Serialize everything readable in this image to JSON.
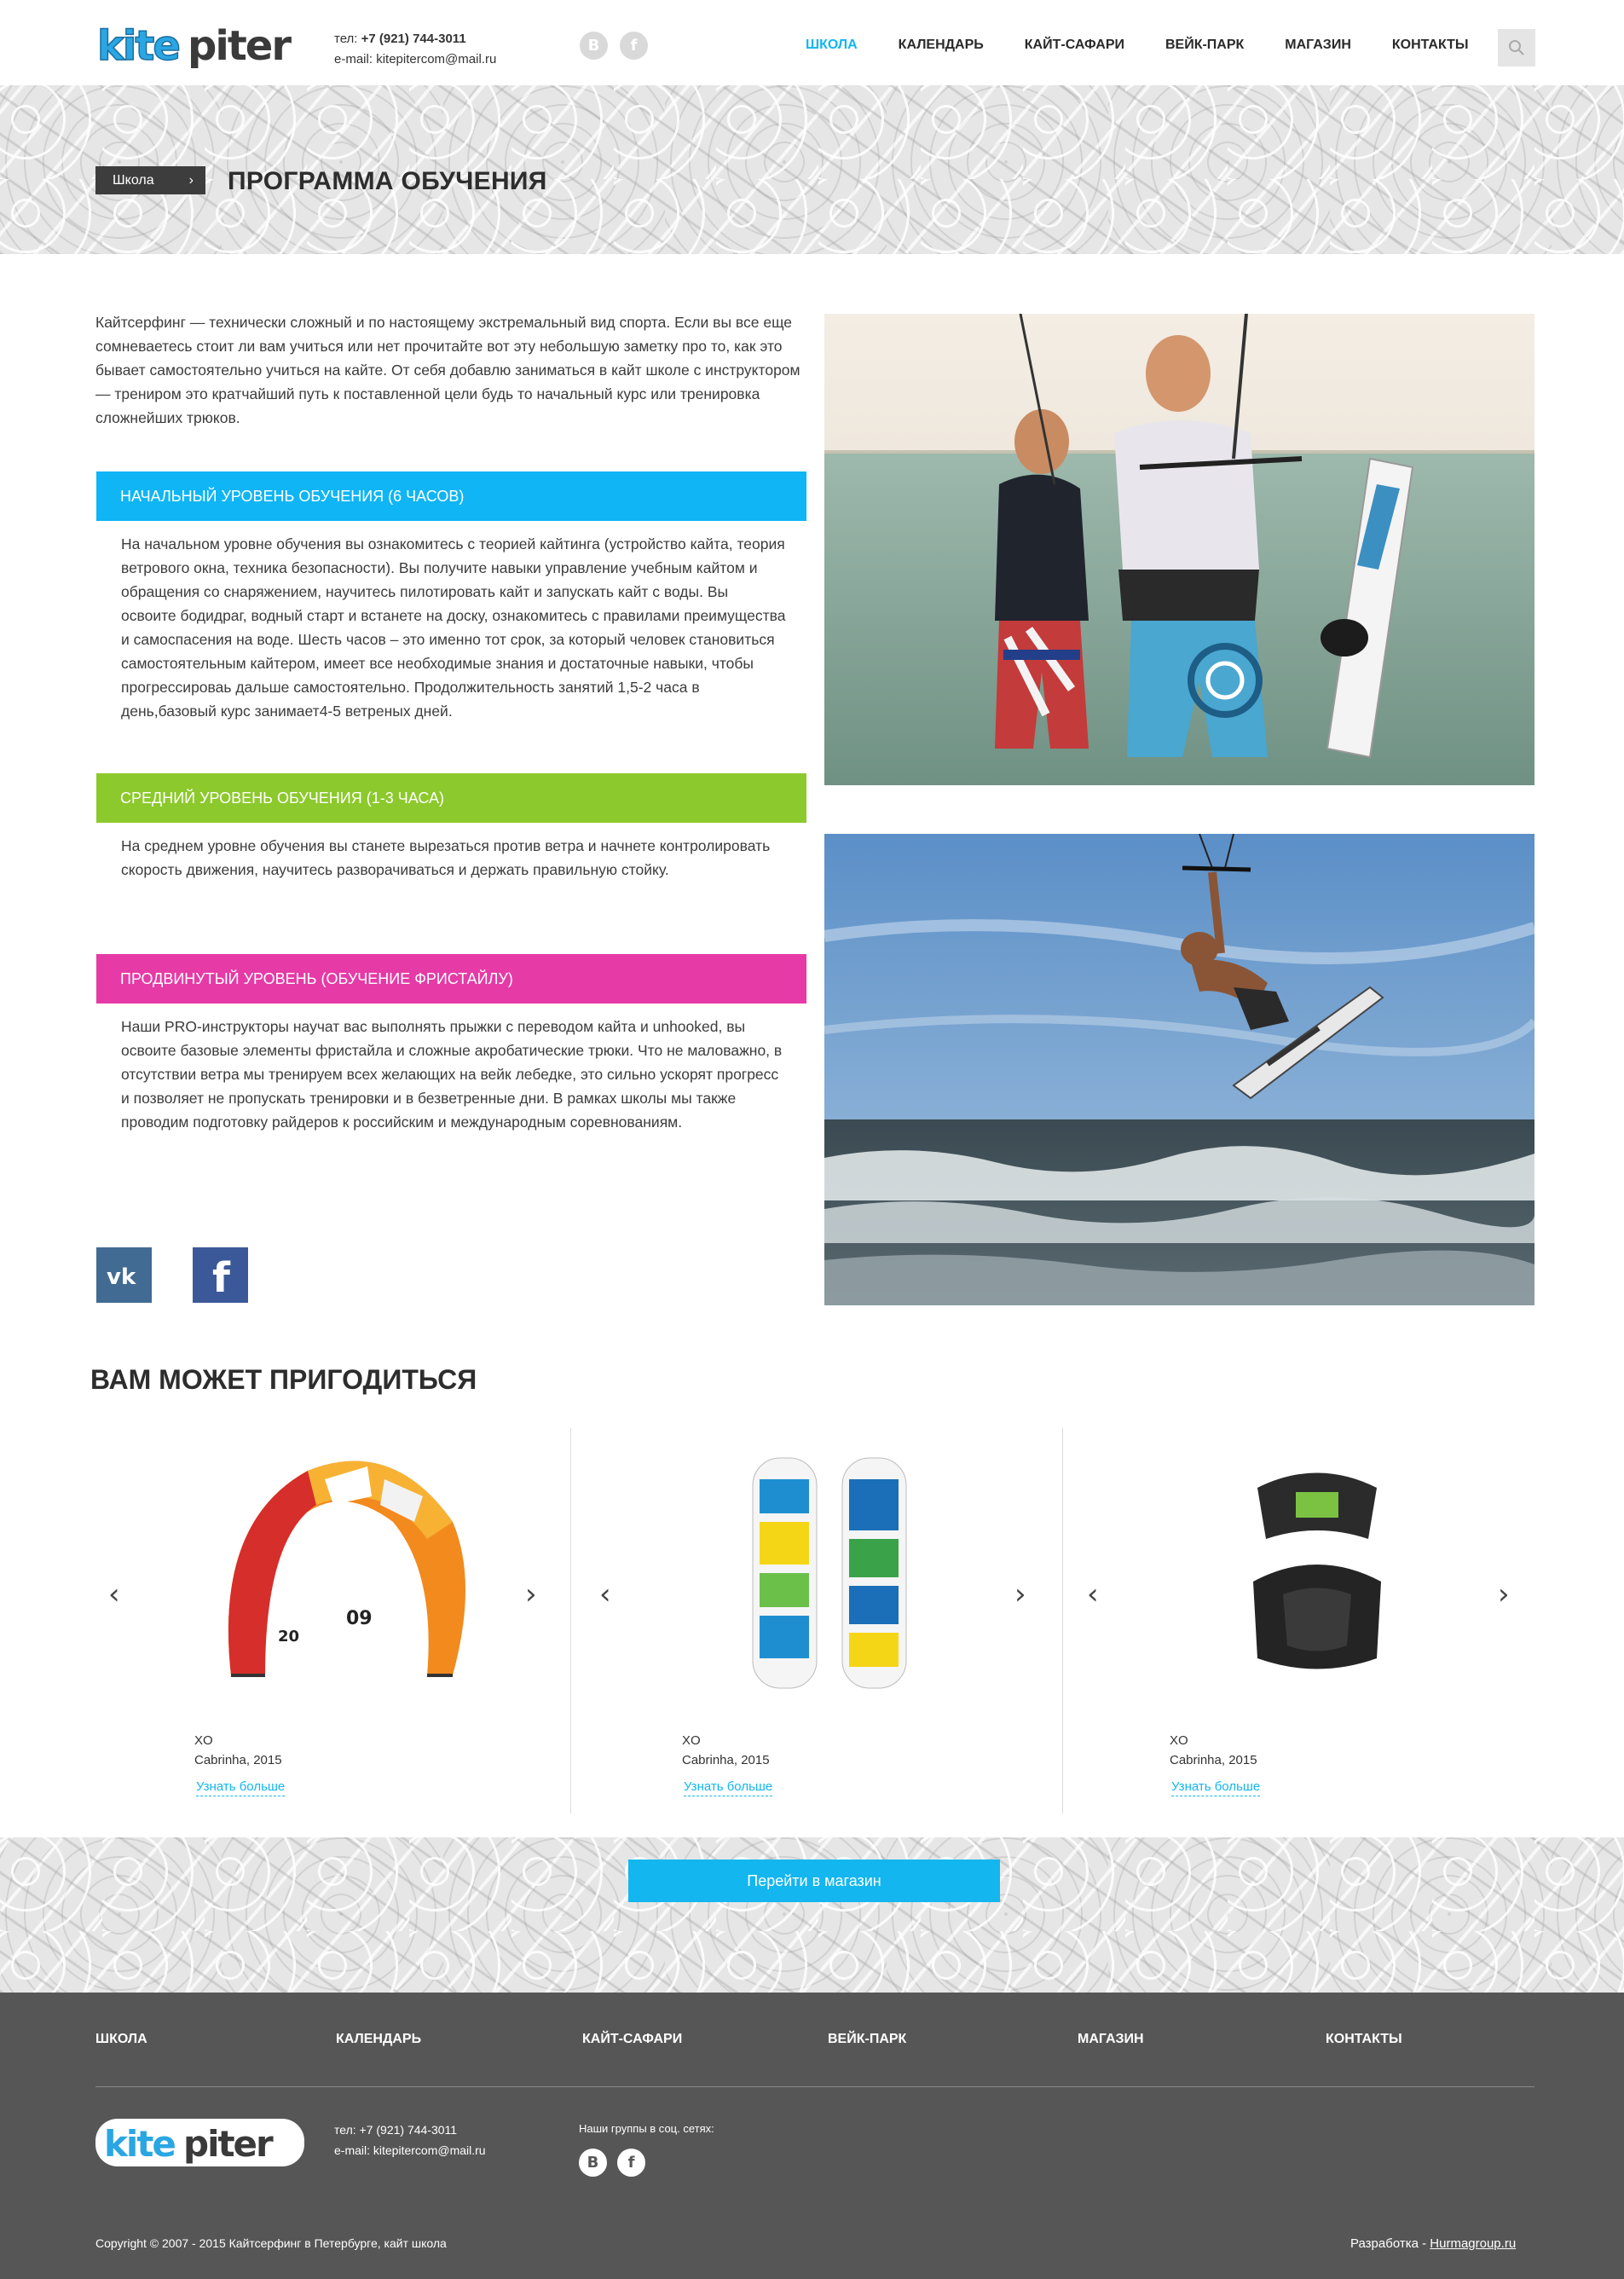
{
  "header": {
    "logo_alt": "kitepiter",
    "phone_label": "тел:",
    "phone": "+7 (921) 744-3011",
    "email_label": "e-mail:",
    "email": "kitepitercom@mail.ru",
    "social": [
      {
        "icon": "vk-icon",
        "glyph": "B"
      },
      {
        "icon": "facebook-icon",
        "glyph": "f"
      }
    ],
    "nav": [
      {
        "label": "Школа",
        "active": true
      },
      {
        "label": "Календарь",
        "active": false
      },
      {
        "label": "Кайт-сафари",
        "active": false
      },
      {
        "label": "Вейк-парк",
        "active": false
      },
      {
        "label": "Магазин",
        "active": false
      },
      {
        "label": "Контакты",
        "active": false
      }
    ],
    "search_icon": "search-icon"
  },
  "hero": {
    "breadcrumb": "Школа",
    "title": "Программа обучения"
  },
  "intro": "Кайтсерфинг — технически сложный и по настоящему экстремальный вид спорта.  Если вы все еще сомневаетесь стоит ли вам учиться или нет прочитайте вот эту небольшую заметку про то, как это бывает самостоятельно учиться на кайте.  От себя добавлю заниматься в кайт школе с инструктором — трениром это кратчайший путь к поставленной цели будь то начальный курс или тренировка сложнейших трюков.",
  "levels": [
    {
      "title": "Начальный уровень обучения (6 часов)",
      "color": "#0fb5f4",
      "text": "На начальном уровне обучения вы ознакомитесь с теорией кайтинга (устройство кайта, теория ветрового окна, техника безопасности). Вы получите навыки управление учебным кайтом и обращения со снаряжением, научитесь пилотировать кайт и запускать кайт с воды. Вы освоите бодидраг, водный старт и встанете на доску, ознакомитесь с правилами преимущества и самоспасения на воде. Шесть часов – это именно тот срок, за который человек становиться самостоятельным кайтером, имеет все необходимые знания и достаточные навыки, чтобы прогрессироваь дальше самостоятельно. Продолжительность занятий 1,5-2 часа в день,базовый курс занимает4-5 ветреных дней."
    },
    {
      "title": "Средний уровень обучения (1-3 часа)",
      "color": "#8cc92c",
      "text": "На среднем уровне обучения вы станете вырезаться против ветра и начнете контролировать скорость движения, научитесь разворачиваться и держать правильную стойку."
    },
    {
      "title": "Продвинутый уровень (обучение фристайлу)",
      "color": "#e63aa6",
      "text": "Наши PRO-инструкторы научат вас выполнять прыжки с переводом кайта и unhooked, вы освоите базовые элементы фристайла и сложные акробатические трюки. Что не маловажно, в отсутствии ветра мы тренируем всех желающих на вейк лебедке, это сильно ускорят прогресс и позволяет не пропускать тренировки и в безветренные дни. В рамках школы мы также проводим подготовку райдеров к российским и международным соревнованиям."
    }
  ],
  "share": [
    {
      "icon": "vk-icon",
      "color": "#416b93"
    },
    {
      "icon": "facebook-icon",
      "color": "#3b5998"
    }
  ],
  "related": {
    "title": "Вам может пригодиться",
    "items": [
      {
        "icon": "kite-icon",
        "name": "XO",
        "brand": "Cabrinha, 2015",
        "more": "Узнать больше"
      },
      {
        "icon": "kiteboard-icon",
        "name": "XO",
        "brand": "Cabrinha, 2015",
        "more": "Узнать больше"
      },
      {
        "icon": "harness-icon",
        "name": "XO",
        "brand": "Cabrinha, 2015",
        "more": "Узнать больше"
      }
    ],
    "prev_glyph": "‹",
    "next_glyph": "›",
    "shop_button": "Перейти в магазин"
  },
  "footer": {
    "nav": [
      "Школа",
      "Календарь",
      "Кайт-сафари",
      "Вейк-парк",
      "Магазин",
      "Контакты"
    ],
    "phone_line": "тел: +7 (921) 744-3011",
    "email_line": "e-mail: kitepitercom@mail.ru",
    "social_label": "Наши группы в соц. сетях:",
    "copyright": "Copyright © 2007 - 2015 Кайтсерфинг в Петербурге, кайт школа",
    "dev_label": "Разработка - ",
    "dev_link": "Hurmagroup.ru"
  },
  "colors": {
    "accent": "#13b6ee",
    "footer_bg": "#565656",
    "breadcrumb_bg": "#3d3d3d"
  }
}
